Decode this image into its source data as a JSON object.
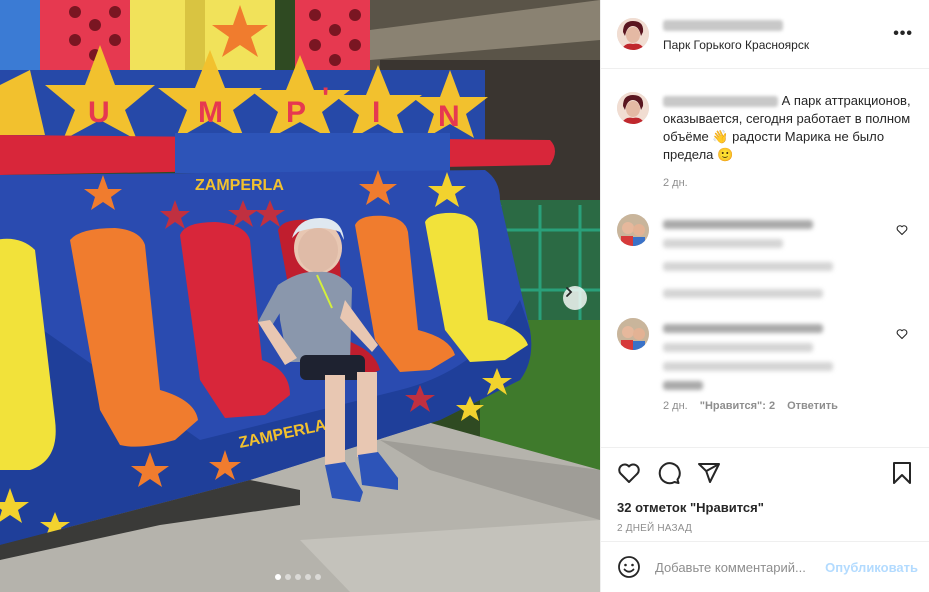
{
  "post": {
    "location": "Парк Горького Красноярск",
    "more_label": "•••",
    "caption_text": "А парк аттракционов, оказывается, сегодня работает в полном объёме 👋 радости Марика не было предела 🙂",
    "caption_time": "2 дн.",
    "ride_sign_letters": [
      "U",
      "M",
      "P",
      "'",
      "I",
      "N"
    ],
    "ride_brand_top": "ZAMPERLA",
    "ride_brand_bottom": "ZAMPERLA"
  },
  "comments": [
    {
      "meta_time": "",
      "likes_label": "",
      "reply_label": ""
    },
    {
      "meta_time": "2 дн.",
      "likes_label": "\"Нравится\": 2",
      "reply_label": "Ответить"
    }
  ],
  "actions": {
    "likes_count": "32 отметок \"Нравится\"",
    "date": "2 ДНЕЙ НАЗАД"
  },
  "add_comment": {
    "placeholder": "Добавьте комментарий...",
    "publish_label": "Опубликовать"
  },
  "carousel": {
    "total": 5,
    "active_index": 0
  },
  "colors": {
    "accent": "#0095f6",
    "publish_disabled": "#b3dbff",
    "muted": "#8e8e8e"
  },
  "icons": [
    "heart-icon",
    "comment-icon",
    "share-icon",
    "bookmark-icon",
    "emoji-icon",
    "chevron-right-icon",
    "more-icon"
  ]
}
